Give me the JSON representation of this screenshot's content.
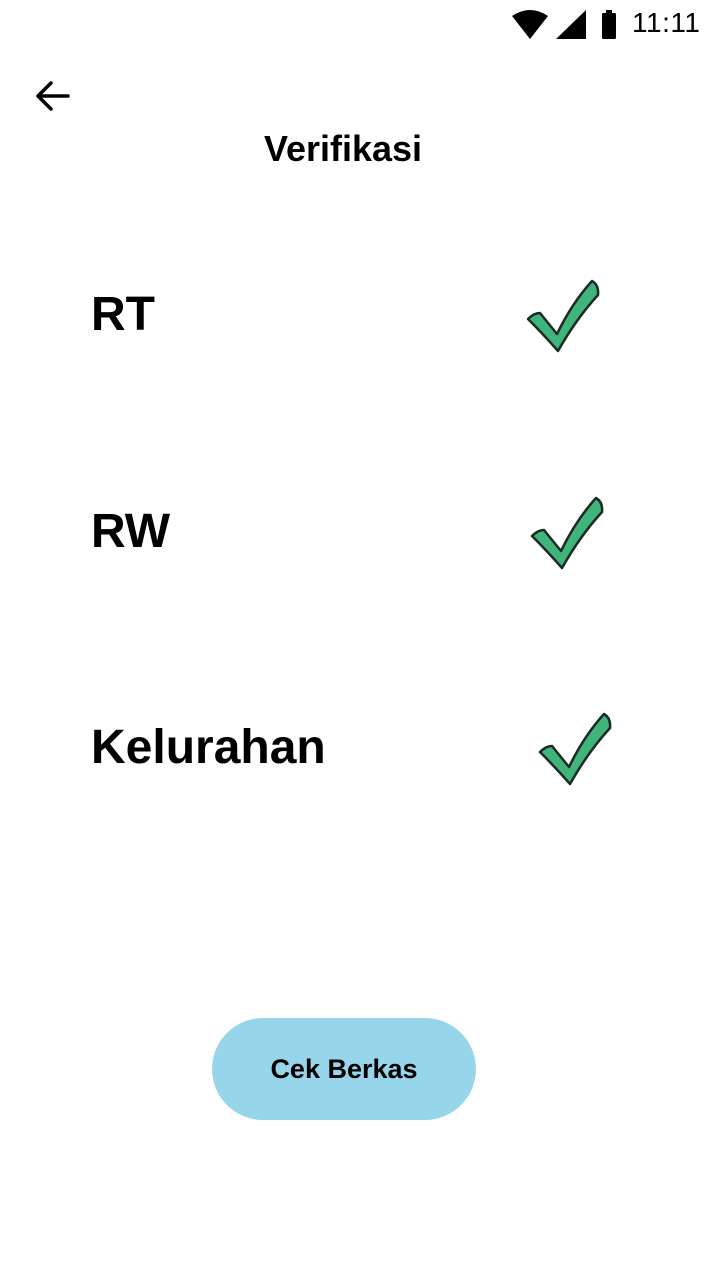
{
  "status_bar": {
    "time": "11:11",
    "icons": [
      "wifi-icon",
      "cell-signal-icon",
      "battery-icon"
    ]
  },
  "header": {
    "back_icon": "arrow-left-icon",
    "title": "Verifikasi"
  },
  "verifications": [
    {
      "label": "RT",
      "status_icon": "checkmark-icon"
    },
    {
      "label": "RW",
      "status_icon": "checkmark-icon"
    },
    {
      "label": "Kelurahan",
      "status_icon": "checkmark-icon"
    }
  ],
  "actions": {
    "cek_berkas_label": "Cek Berkas"
  },
  "colors": {
    "check_fill": "#3fb57c",
    "button_bg": "#97d5ea",
    "text": "#000000",
    "background": "#ffffff"
  }
}
